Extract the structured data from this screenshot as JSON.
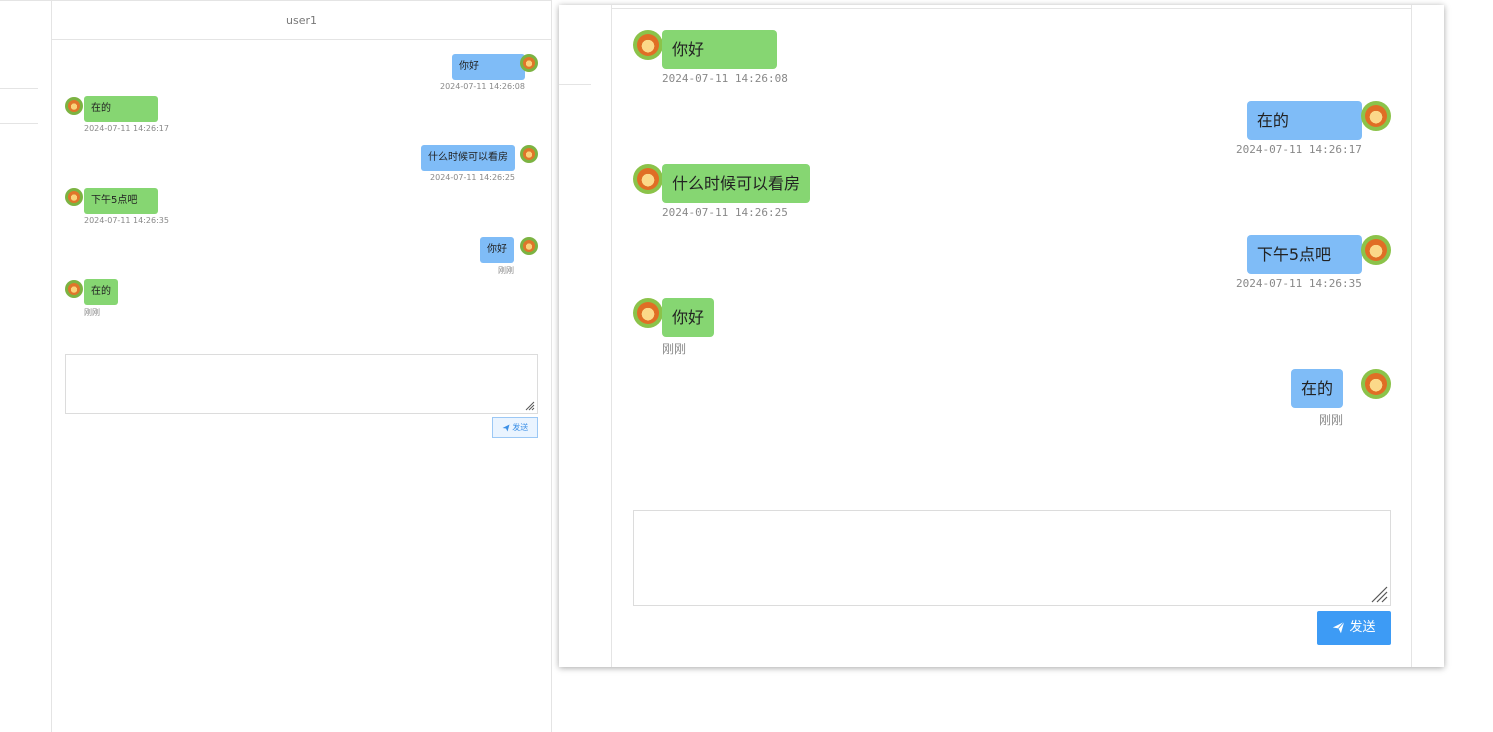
{
  "conversation": {
    "title": "user1",
    "messages": [
      {
        "side": "right",
        "text": "你好",
        "time": "2024-07-11 14:26:08"
      },
      {
        "side": "left",
        "text": "在的",
        "time": "2024-07-11 14:26:17"
      },
      {
        "side": "right",
        "text": "什么时候可以看房",
        "time": "2024-07-11 14:26:25"
      },
      {
        "side": "left",
        "text": "下午5点吧",
        "time": "2024-07-11 14:26:35"
      },
      {
        "side": "right",
        "text": "你好",
        "time": "刚刚"
      },
      {
        "side": "left",
        "text": "在的",
        "time": "刚刚"
      }
    ],
    "send_label": "发送"
  },
  "modal": {
    "messages": [
      {
        "side": "left",
        "text": "你好",
        "time": "2024-07-11 14:26:08"
      },
      {
        "side": "right",
        "text": "在的",
        "time": "2024-07-11 14:26:17"
      },
      {
        "side": "left",
        "text": "什么时候可以看房",
        "time": "2024-07-11 14:26:25"
      },
      {
        "side": "right",
        "text": "下午5点吧",
        "time": "2024-07-11 14:26:35"
      },
      {
        "side": "left",
        "text": "你好",
        "time": "刚刚"
      },
      {
        "side": "right",
        "text": "在的",
        "time": "刚刚"
      }
    ],
    "send_label": "发送"
  },
  "colors": {
    "self_bubble": "#7fbcf7",
    "other_bubble": "#86d672",
    "send_button": "#3d9bf5"
  },
  "icons": [
    "lion-avatar-icon",
    "paper-plane-icon",
    "resize-handle-icon"
  ]
}
